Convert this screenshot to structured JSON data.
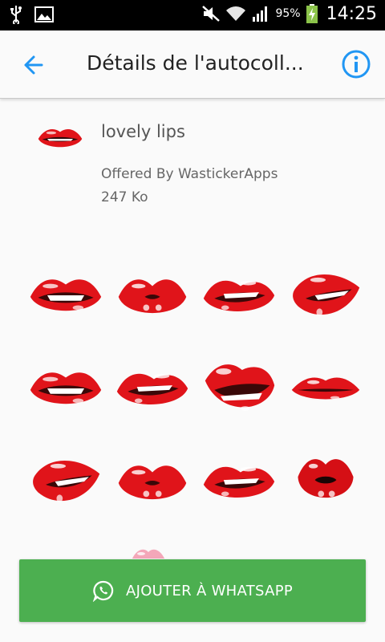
{
  "status_bar": {
    "battery": "95%",
    "time": "14:25",
    "icons": [
      "usb-icon",
      "image-icon",
      "mute-icon",
      "wifi-icon",
      "signal-icon",
      "battery-icon"
    ]
  },
  "app_bar": {
    "title": "Détails de l'autocoll...",
    "back_icon": "arrow-back-icon",
    "info_icon": "info-icon",
    "accent": "#2196f3"
  },
  "pack": {
    "name": "lovely lips",
    "publisher": "Offered By WastickerApps",
    "size": "247 Ko"
  },
  "stickers": [
    {
      "variant": "smile"
    },
    {
      "variant": "pout"
    },
    {
      "variant": "bite"
    },
    {
      "variant": "side"
    },
    {
      "variant": "smile"
    },
    {
      "variant": "bite"
    },
    {
      "variant": "grin"
    },
    {
      "variant": "thin"
    },
    {
      "variant": "side"
    },
    {
      "variant": "pout"
    },
    {
      "variant": "bite"
    },
    {
      "variant": "kiss"
    }
  ],
  "cta": {
    "label": "AJOUTER À WHATSAPP",
    "icon": "whatsapp-icon",
    "color": "#4caf50"
  }
}
